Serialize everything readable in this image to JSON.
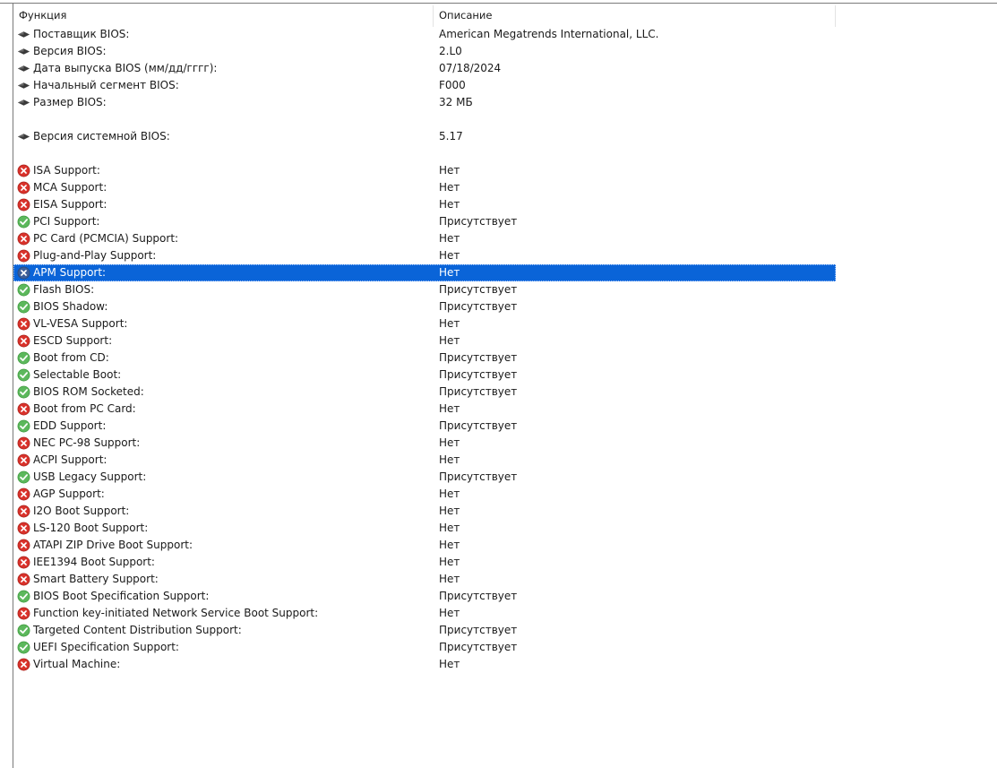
{
  "columns": {
    "feature": "Функция",
    "description": "Описание"
  },
  "rows": [
    {
      "type": "info",
      "icon": "diamond-icon",
      "label": "Поставщик BIOS:",
      "value": "American Megatrends International, LLC."
    },
    {
      "type": "info",
      "icon": "diamond-icon",
      "label": "Версия BIOS:",
      "value": "2.L0"
    },
    {
      "type": "info",
      "icon": "diamond-icon",
      "label": "Дата выпуска BIOS (мм/дд/гггг):",
      "value": "07/18/2024"
    },
    {
      "type": "info",
      "icon": "diamond-icon",
      "label": "Начальный сегмент BIOS:",
      "value": "F000"
    },
    {
      "type": "info",
      "icon": "diamond-icon",
      "label": "Размер BIOS:",
      "value": "32 МБ"
    },
    {
      "type": "blank"
    },
    {
      "type": "info",
      "icon": "diamond-icon",
      "label": "Версия системной BIOS:",
      "value": "5.17"
    },
    {
      "type": "blank"
    },
    {
      "type": "no",
      "label": "ISA Support:",
      "value": "Нет"
    },
    {
      "type": "no",
      "label": "MCA Support:",
      "value": "Нет"
    },
    {
      "type": "no",
      "label": "EISA Support:",
      "value": "Нет"
    },
    {
      "type": "yes",
      "label": "PCI Support:",
      "value": "Присутствует"
    },
    {
      "type": "no",
      "label": "PC Card (PCMCIA) Support:",
      "value": "Нет"
    },
    {
      "type": "no",
      "label": "Plug-and-Play Support:",
      "value": "Нет"
    },
    {
      "type": "no",
      "label": "APM Support:",
      "value": "Нет",
      "selected": true
    },
    {
      "type": "yes",
      "label": "Flash BIOS:",
      "value": "Присутствует"
    },
    {
      "type": "yes",
      "label": "BIOS Shadow:",
      "value": "Присутствует"
    },
    {
      "type": "no",
      "label": "VL-VESA Support:",
      "value": "Нет"
    },
    {
      "type": "no",
      "label": "ESCD Support:",
      "value": "Нет"
    },
    {
      "type": "yes",
      "label": "Boot from CD:",
      "value": "Присутствует"
    },
    {
      "type": "yes",
      "label": "Selectable Boot:",
      "value": "Присутствует"
    },
    {
      "type": "yes",
      "label": "BIOS ROM Socketed:",
      "value": "Присутствует"
    },
    {
      "type": "no",
      "label": "Boot from PC Card:",
      "value": "Нет"
    },
    {
      "type": "yes",
      "label": "EDD Support:",
      "value": "Присутствует"
    },
    {
      "type": "no",
      "label": "NEC PC-98 Support:",
      "value": "Нет"
    },
    {
      "type": "no",
      "label": "ACPI Support:",
      "value": "Нет"
    },
    {
      "type": "yes",
      "label": "USB Legacy Support:",
      "value": "Присутствует"
    },
    {
      "type": "no",
      "label": "AGP Support:",
      "value": "Нет"
    },
    {
      "type": "no",
      "label": "I2O Boot Support:",
      "value": "Нет"
    },
    {
      "type": "no",
      "label": "LS-120 Boot Support:",
      "value": "Нет"
    },
    {
      "type": "no",
      "label": "ATAPI ZIP Drive Boot Support:",
      "value": "Нет"
    },
    {
      "type": "no",
      "label": "IEE1394 Boot Support:",
      "value": "Нет"
    },
    {
      "type": "no",
      "label": "Smart Battery Support:",
      "value": "Нет"
    },
    {
      "type": "yes",
      "label": "BIOS Boot Specification Support:",
      "value": "Присутствует"
    },
    {
      "type": "no",
      "label": "Function key-initiated Network Service Boot Support:",
      "value": "Нет"
    },
    {
      "type": "yes",
      "label": "Targeted Content Distribution Support:",
      "value": "Присутствует"
    },
    {
      "type": "yes",
      "label": "UEFI Specification Support:",
      "value": "Присутствует"
    },
    {
      "type": "no",
      "label": "Virtual Machine:",
      "value": "Нет"
    }
  ],
  "icons": {
    "info": "diamond-icon",
    "yes": "check-circle-icon",
    "no": "x-circle-icon"
  },
  "colors": {
    "selection": "#0a64d8",
    "yes": "#5cb85c",
    "no": "#d9322b",
    "selected_no": "#3d5f9a"
  }
}
